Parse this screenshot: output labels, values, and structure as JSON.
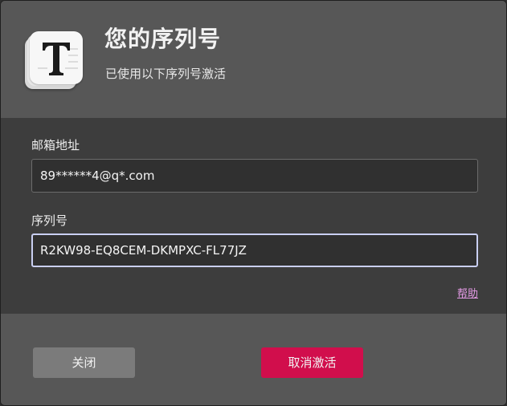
{
  "dialog": {
    "title": "您的序列号",
    "subtitle": "已使用以下序列号激活",
    "app_icon": "typora-t-icon"
  },
  "form": {
    "email_label": "邮箱地址",
    "email_value": "89******4@q*.com",
    "serial_label": "序列号",
    "serial_value": "R2KW98-EQ8CEM-DKMPXC-FL77JZ",
    "help_link": "帮助"
  },
  "buttons": {
    "close_label": "关闭",
    "deactivate_label": "取消激活"
  },
  "colors": {
    "header_bg": "#575757",
    "body_bg": "#3d3d3d",
    "accent_button": "#d10e4c",
    "secondary_button": "#7b7b7b",
    "link": "#e59be6",
    "focus_border": "#c9cff2"
  }
}
